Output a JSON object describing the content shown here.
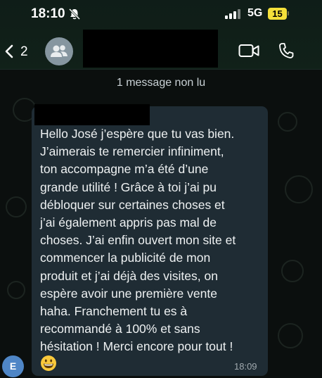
{
  "status_bar": {
    "time": "18:10",
    "network": "5G",
    "battery": "15"
  },
  "header": {
    "back_count": "2",
    "icons": [
      "chevron-left-icon",
      "group-avatar-icon",
      "video-call-icon",
      "phone-icon"
    ]
  },
  "chat": {
    "unread_banner": "1 message non lu",
    "message": {
      "text": "Hello José j’espère que tu vas bien.\nJ’aimerais te remercier infiniment,\nton accompagne m’a été d’une\ngrande utilité ! Grâce à toi j’ai pu\ndébloquer sur certaines choses et\nj’ai également appris pas mal de\nchoses. J’ai enfin ouvert mon site et\ncommencer la publicité de mon\nproduit et j’ai déjà des visites, on\nespère avoir une première vente\nhaha. Franchement tu es à\nrecommandé à 100% et sans\nhésitation ! Merci encore pour tout !",
      "emoji": "grinning-face-icon",
      "time": "18:09"
    },
    "sender_initial": "E"
  },
  "colors": {
    "bubble": "#1f2c34",
    "battery": "#f4e03a",
    "header": "#112119",
    "avatar": "#4f86c6"
  }
}
